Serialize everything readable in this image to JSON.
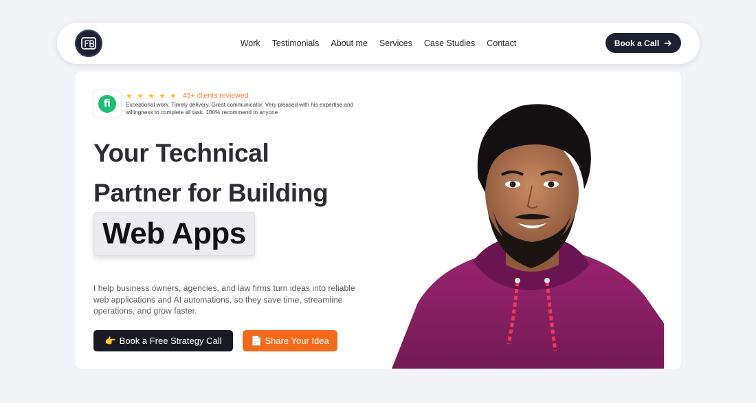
{
  "header": {
    "nav_links": [
      "Work",
      "Testimonials",
      "About me",
      "Services",
      "Case Studies",
      "Contact"
    ],
    "cta_label": "Book a Call"
  },
  "hero": {
    "review": {
      "platform_icon": "fiverr-icon",
      "stars": 5,
      "count_label": "45+ clients reviewed",
      "text": "Exceptional work. Timely delivery. Great communicator. Very pleased with his expertise and willingness to complete all task. 100% recommend to anyone"
    },
    "headline_line1": "Your Technical",
    "headline_line2": "Partner for Building",
    "highlight": "Web Apps",
    "description": "I help business owners, agencies, and law firms turn ideas into reliable web applications and AI automations, so they save time, streamline operations, and grow faster.",
    "primary_button": {
      "emoji": "👉",
      "label": "Book a Free Strategy Call"
    },
    "secondary_button": {
      "emoji": "📄",
      "label": "Share Your Idea"
    }
  },
  "colors": {
    "page_bg": "#f3f4f8",
    "dark": "#1c2233",
    "accent_orange": "#f26b1d",
    "fiverr_green": "#1dbf73",
    "star_yellow": "#f5c518",
    "hoodie": "#8a1f63"
  }
}
